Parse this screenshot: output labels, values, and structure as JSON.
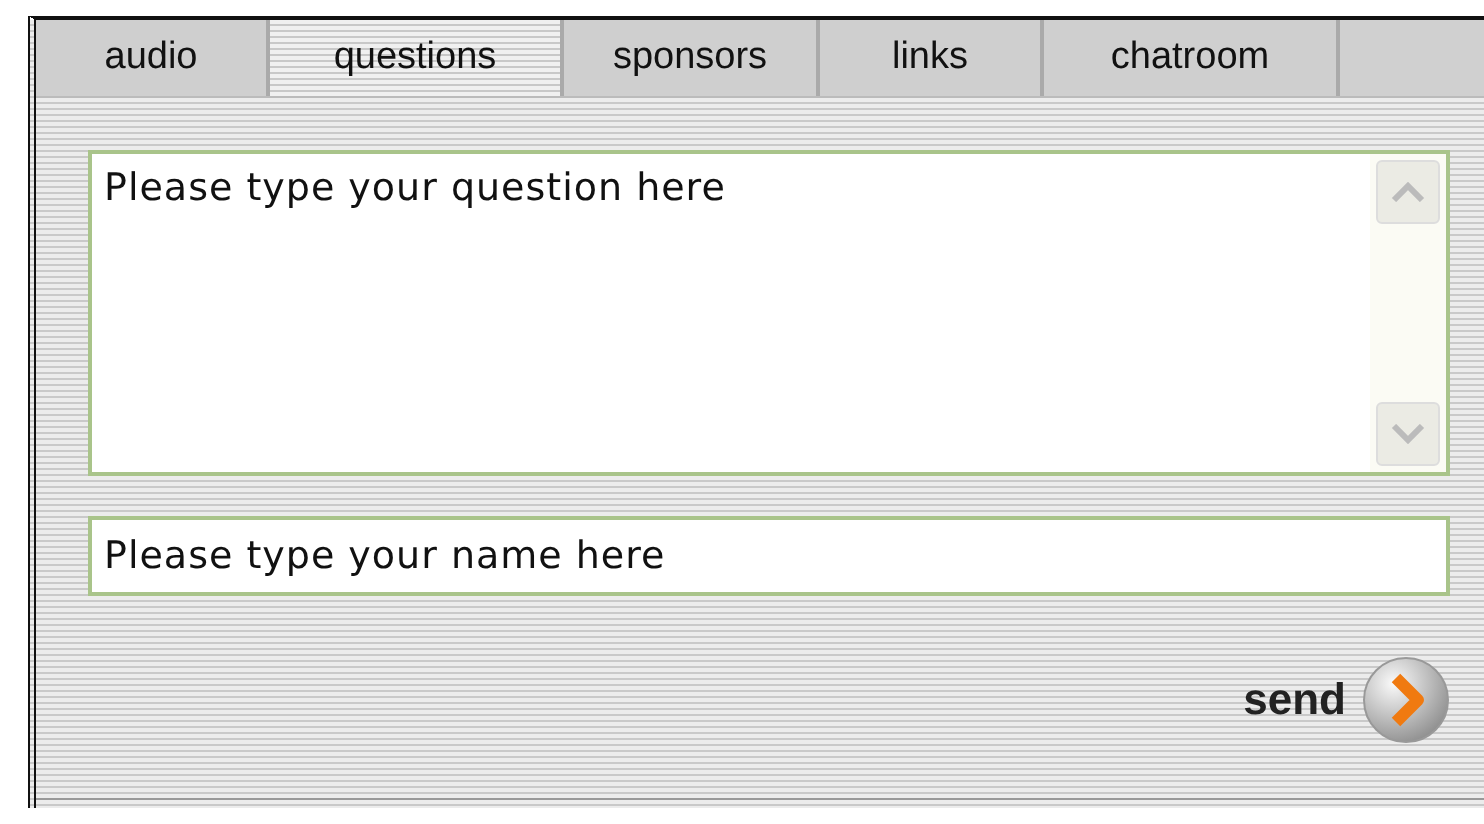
{
  "tabs": [
    {
      "label": "audio",
      "selected": false
    },
    {
      "label": "questions",
      "selected": true
    },
    {
      "label": "sponsors",
      "selected": false
    },
    {
      "label": "links",
      "selected": false
    },
    {
      "label": "chatroom",
      "selected": false
    }
  ],
  "question_field": {
    "value": "Please type your question here"
  },
  "name_field": {
    "value": "Please type your name here"
  },
  "send_button": {
    "label": "send"
  }
}
